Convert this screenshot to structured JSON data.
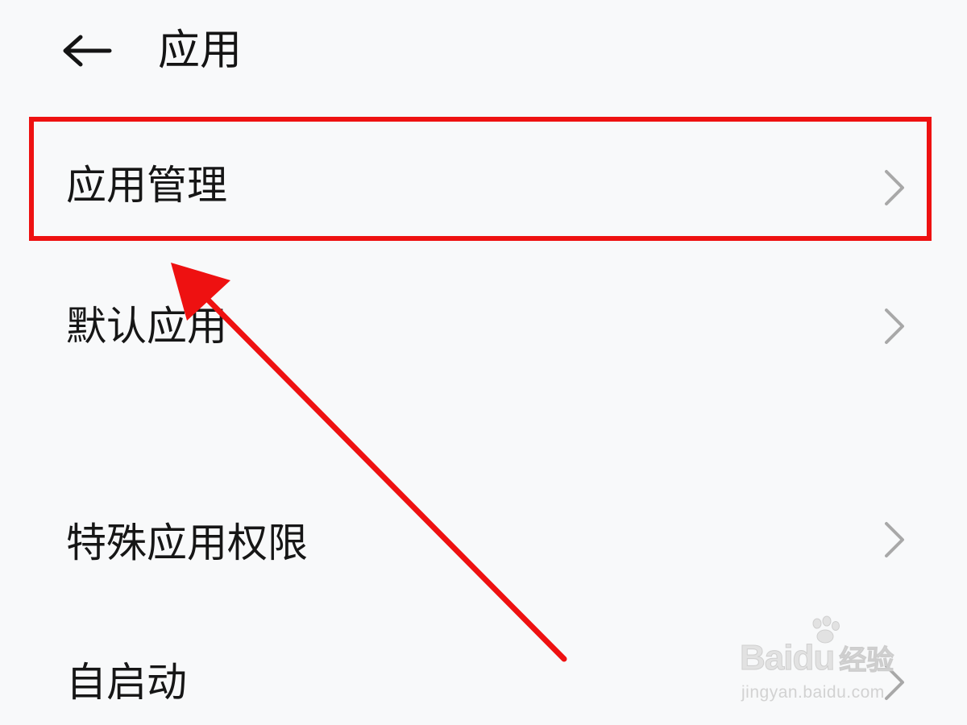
{
  "header": {
    "back_icon": "arrow-left-icon",
    "title": "应用"
  },
  "list": {
    "items": [
      {
        "label": "应用管理",
        "icon": "chevron-right-icon",
        "highlighted": true
      },
      {
        "label": "默认应用",
        "icon": "chevron-right-icon"
      },
      {
        "label": "特殊应用权限",
        "icon": "chevron-right-icon"
      },
      {
        "label": "自启动",
        "icon": "chevron-right-icon"
      }
    ]
  },
  "annotation": {
    "box_color": "#ee1111",
    "arrow_color": "#ee1111"
  },
  "watermark": {
    "brand": "Baidu",
    "suffix": "经验",
    "url": "jingyan.baidu.com"
  },
  "colors": {
    "background": "#f8f9fa",
    "text": "#141414",
    "chevron": "#a8a8a8"
  }
}
